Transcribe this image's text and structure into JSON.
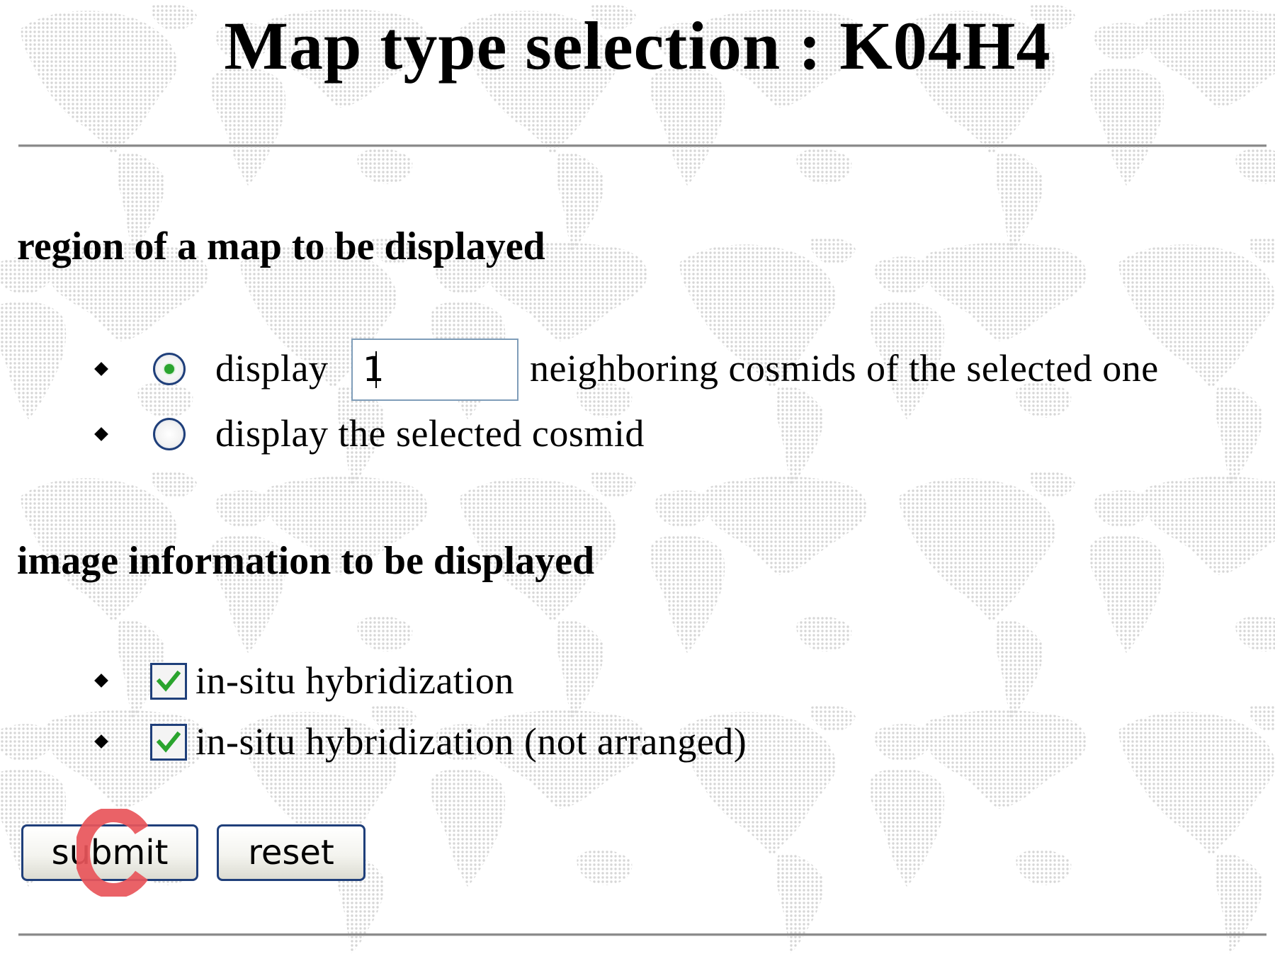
{
  "page": {
    "title": "Map type selection : K04H4",
    "background_pattern": "world-map-dots",
    "pattern_color": "#d9d9d9"
  },
  "region_section": {
    "heading": "region of a map to be displayed",
    "options": [
      {
        "selected": true,
        "prefix": "display",
        "input_value": "1",
        "suffix": "neighboring cosmids of the selected one"
      },
      {
        "selected": false,
        "label": "display the selected cosmid"
      }
    ]
  },
  "image_section": {
    "heading": "image information to be displayed",
    "options": [
      {
        "checked": true,
        "label": "in-situ hybridization"
      },
      {
        "checked": true,
        "label": "in-situ hybridization (not arranged)"
      }
    ]
  },
  "buttons": {
    "submit_label": "submit",
    "reset_label": "reset"
  },
  "overlay": {
    "cursor_glyph": "C",
    "cursor_color": "#e8555a"
  },
  "colors": {
    "radio_dot": "#2aa42e",
    "check_mark": "#2aa42e",
    "control_border": "#1f3f7a",
    "input_border": "#7f9db9",
    "rule": "#8c8c8c"
  }
}
